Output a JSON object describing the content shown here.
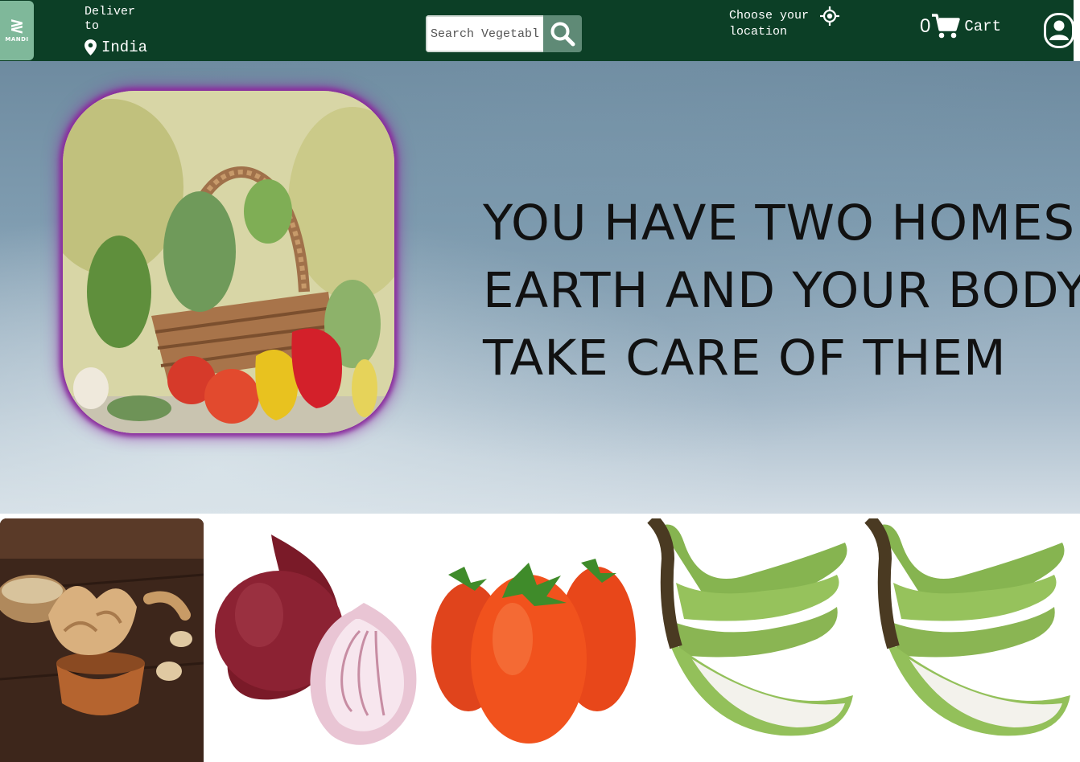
{
  "header": {
    "logo": {
      "mark": "≷",
      "text": "MANDI"
    },
    "deliver": {
      "label": "Deliver to",
      "country": "India"
    },
    "search": {
      "placeholder": "Search Vegetables"
    },
    "location": {
      "label": "Choose your location"
    },
    "cart": {
      "count": "0",
      "label": "Cart"
    }
  },
  "hero": {
    "quote_lines": [
      "YOU HAVE TWO HOMES:",
      "EARTH AND YOUR BODY ,",
      "TAKE CARE OF THEM"
    ]
  },
  "colors": {
    "navbar": "#0c3f26",
    "logo_bg": "#7fb89a",
    "search_button": "#5f8a76",
    "hero_glow": "#8a2c9e"
  },
  "icons": {
    "pin": "map-pin-icon",
    "search": "search-icon",
    "location": "crosshair-location-icon",
    "cart": "shopping-cart-icon",
    "account": "user-account-icon"
  },
  "products": [
    {
      "name": "ginger"
    },
    {
      "name": "onion"
    },
    {
      "name": "tomato"
    },
    {
      "name": "raw banana"
    },
    {
      "name": "raw banana"
    }
  ]
}
